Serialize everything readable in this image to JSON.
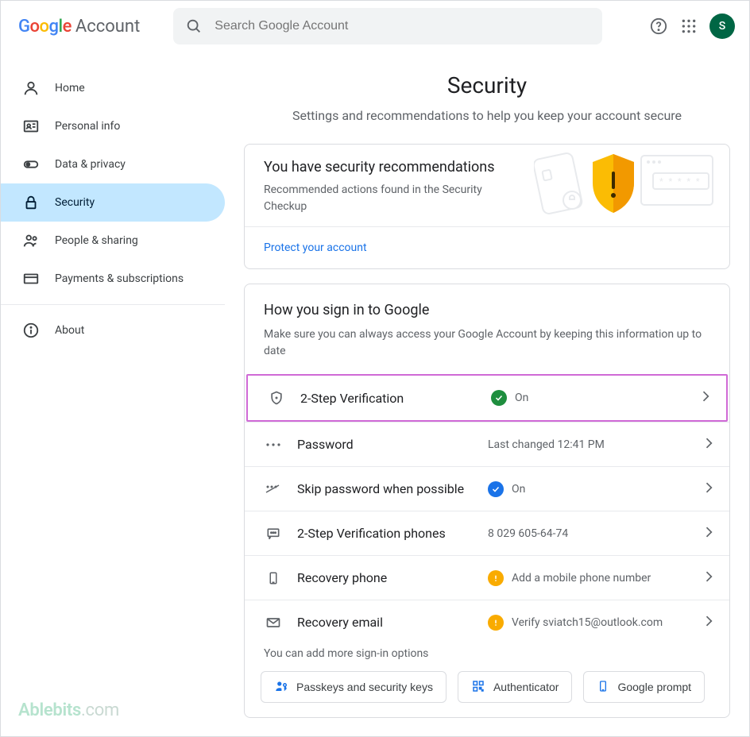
{
  "header": {
    "logo_suffix": "Account",
    "search_placeholder": "Search Google Account",
    "avatar_initial": "S"
  },
  "sidebar": {
    "items": [
      {
        "label": "Home"
      },
      {
        "label": "Personal info"
      },
      {
        "label": "Data & privacy"
      },
      {
        "label": "Security"
      },
      {
        "label": "People & sharing"
      },
      {
        "label": "Payments & subscriptions"
      }
    ],
    "about_label": "About"
  },
  "page": {
    "title": "Security",
    "subtitle": "Settings and recommendations to help you keep your account secure"
  },
  "reco_card": {
    "title": "You have security recommendations",
    "subtitle": "Recommended actions found in the Security Checkup",
    "link": "Protect your account"
  },
  "howsign": {
    "title": "How you sign in to Google",
    "subtitle": "Make sure you can always access your Google Account by keeping this information up to date",
    "rows": {
      "two_step": {
        "label": "2-Step Verification",
        "status": "On"
      },
      "password": {
        "label": "Password",
        "status": "Last changed 12:41 PM"
      },
      "skip_pw": {
        "label": "Skip password when possible",
        "status": "On"
      },
      "phones_2sv": {
        "label": "2-Step Verification phones",
        "status": "8 029 605-64-74"
      },
      "recovery_phone": {
        "label": "Recovery phone",
        "status": "Add a mobile phone number"
      },
      "recovery_email": {
        "label": "Recovery email",
        "status": "Verify sviatch15@outlook.com"
      }
    },
    "more_options_text": "You can add more sign-in options",
    "options": {
      "passkeys": "Passkeys and security keys",
      "authenticator": "Authenticator",
      "google_prompt": "Google prompt"
    }
  },
  "watermark": {
    "brand": "Ablebits",
    "suffix": ".com"
  }
}
